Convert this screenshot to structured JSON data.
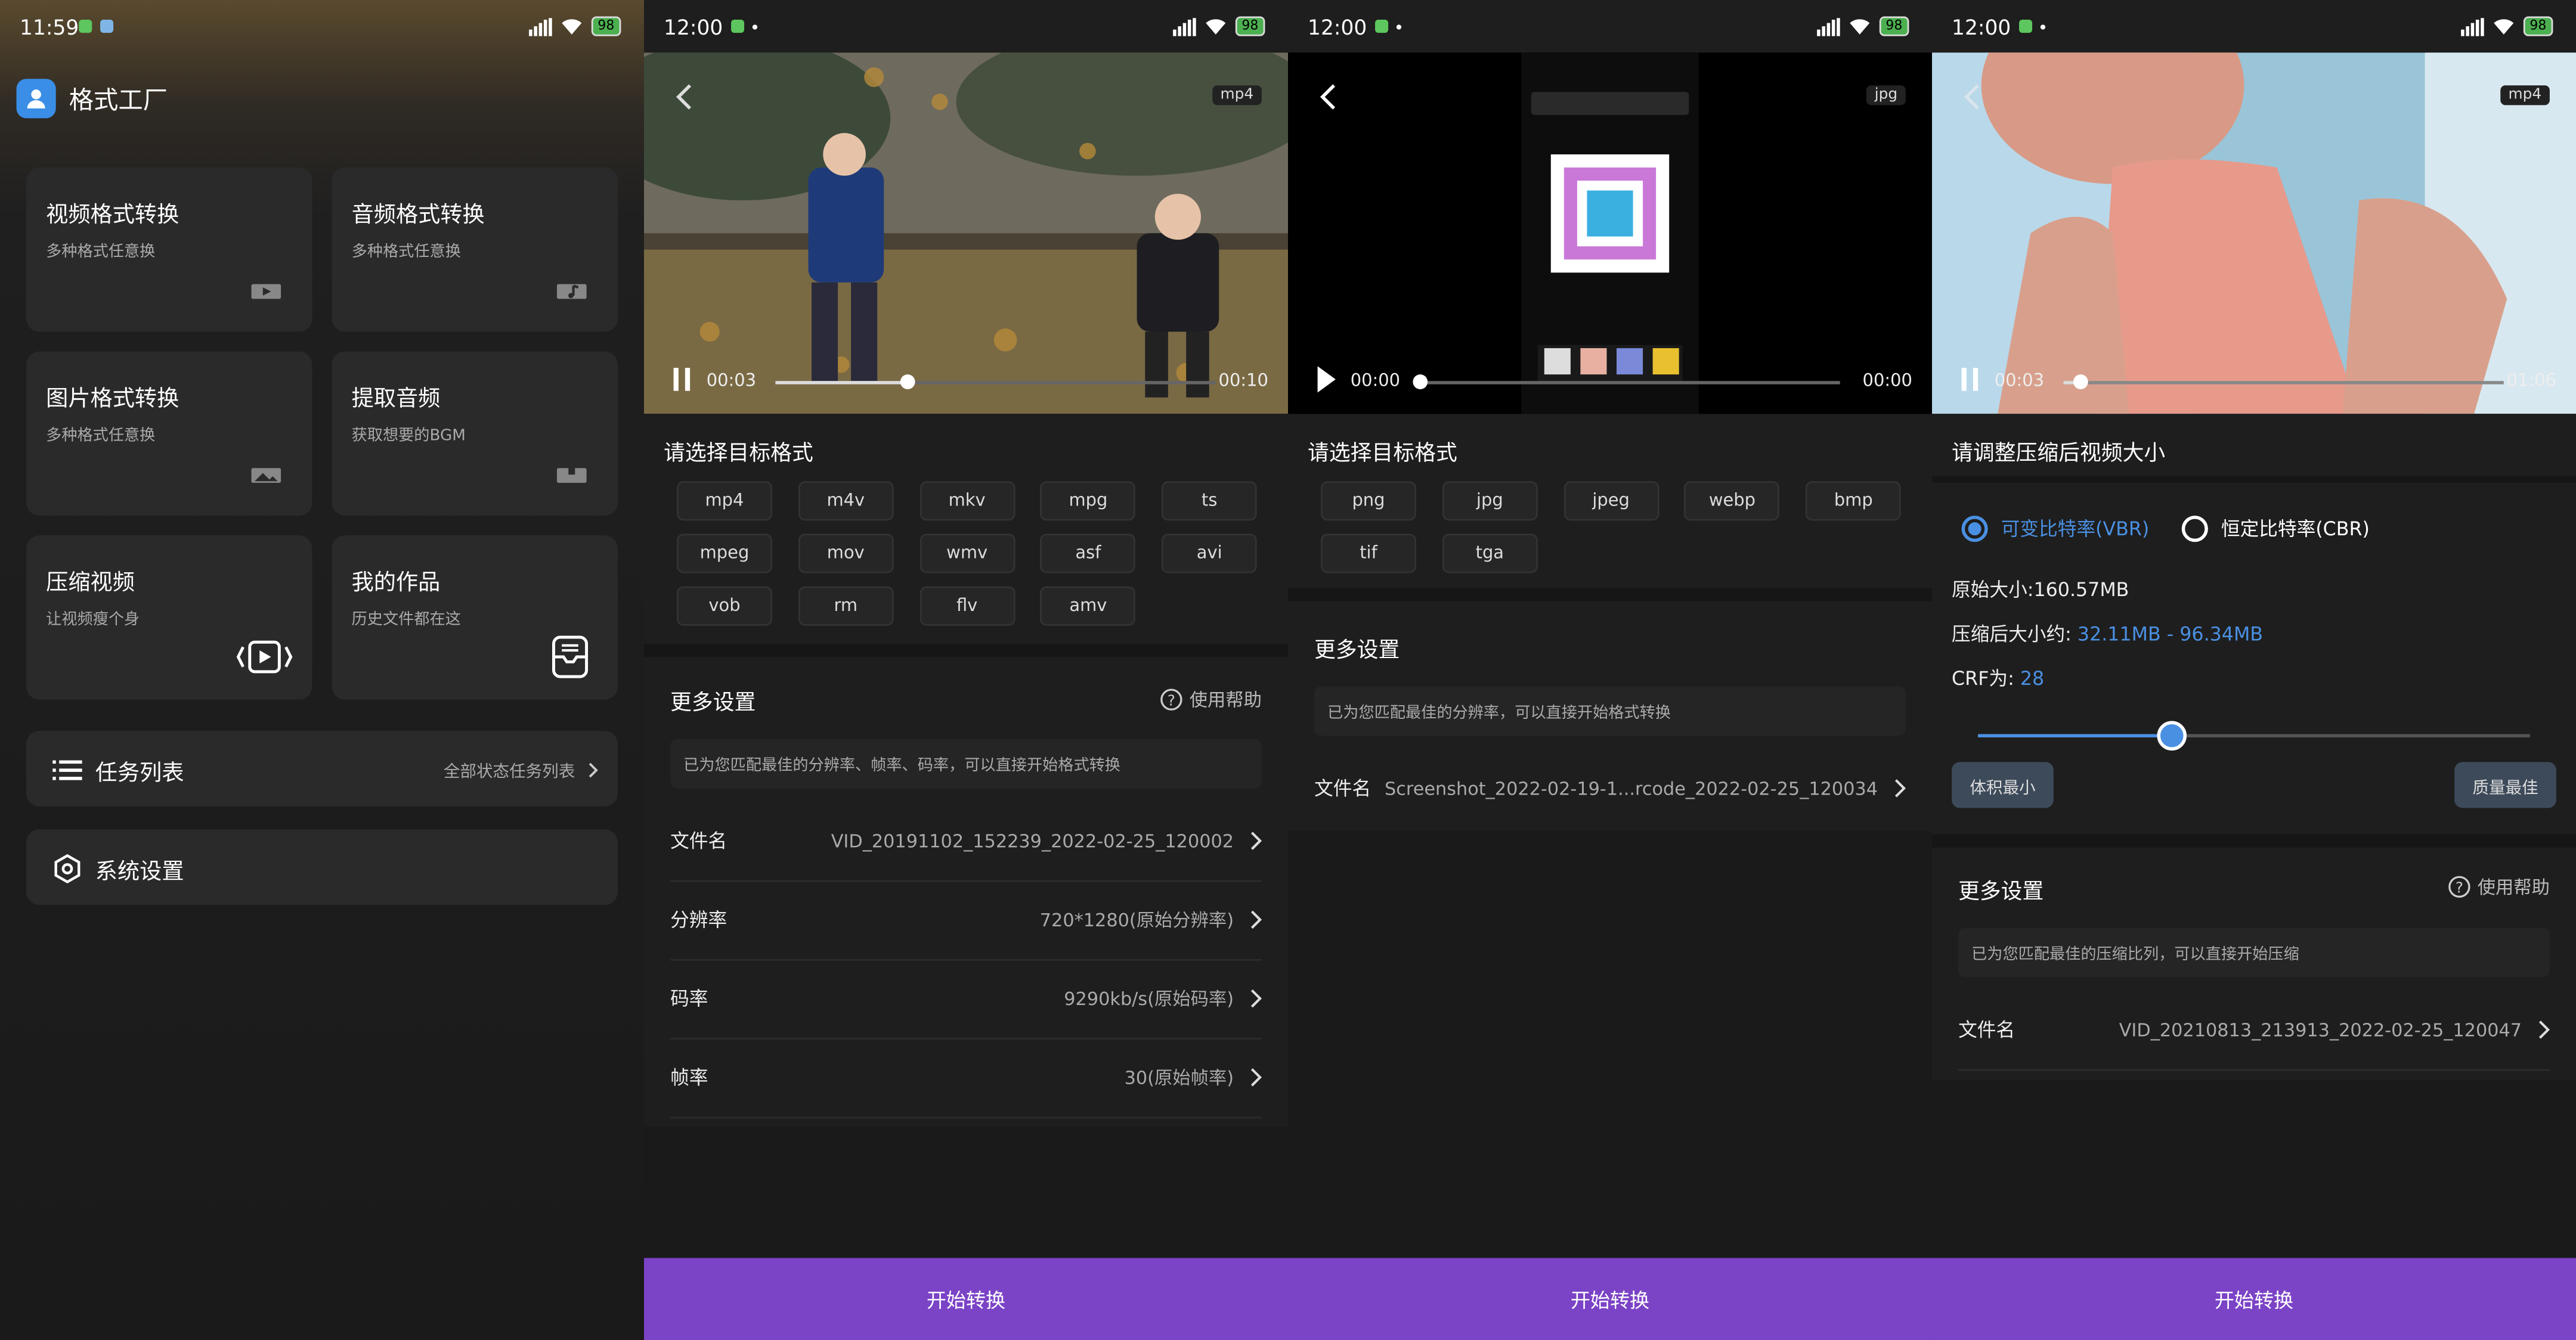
{
  "colors": {
    "accent": "#7b43c6",
    "link": "#4a90e2",
    "bg": "#1e1e1e",
    "card": "#2a2a2a"
  },
  "p1": {
    "status_time": "11:59",
    "battery": "98",
    "app_title": "格式工厂",
    "cards": [
      {
        "title": "视频格式转换",
        "sub": "多种格式任意换",
        "icon": "video-icon"
      },
      {
        "title": "音频格式转换",
        "sub": "多种格式任意换",
        "icon": "music-icon"
      },
      {
        "title": "图片格式转换",
        "sub": "多种格式任意换",
        "icon": "image-icon"
      },
      {
        "title": "提取音频",
        "sub": "获取想要的BGM",
        "icon": "extract-audio-icon"
      },
      {
        "title": "压缩视频",
        "sub": "让视频瘦个身",
        "icon": "compress-icon"
      },
      {
        "title": "我的作品",
        "sub": "历史文件都在这",
        "icon": "archive-icon"
      }
    ],
    "task_list": {
      "label": "任务列表",
      "right": "全部状态任务列表"
    },
    "settings": {
      "label": "系统设置"
    }
  },
  "p2": {
    "status_time": "12:00",
    "battery": "98",
    "format_tag": "mp4",
    "player": {
      "current": "00:03",
      "total": "00:10",
      "progress": 0.3
    },
    "section_title": "请选择目标格式",
    "formats": [
      "mp4",
      "m4v",
      "mkv",
      "mpg",
      "ts",
      "mpeg",
      "mov",
      "wmv",
      "asf",
      "avi",
      "vob",
      "rm",
      "flv",
      "amv"
    ],
    "more_title": "更多设置",
    "help": "使用帮助",
    "hint": "已为您匹配最佳的分辨率、帧率、码率，可以直接开始格式转换",
    "rows": [
      {
        "label": "文件名",
        "value": "VID_20191102_152239_2022-02-25_120002"
      },
      {
        "label": "分辨率",
        "value": "720*1280(原始分辨率)"
      },
      {
        "label": "码率",
        "value": "9290kb/s(原始码率)"
      },
      {
        "label": "帧率",
        "value": "30(原始帧率)"
      }
    ],
    "start": "开始转换"
  },
  "p3": {
    "status_time": "12:00",
    "battery": "98",
    "format_tag": "jpg",
    "player": {
      "current": "00:00",
      "total": "00:00",
      "progress": 0
    },
    "section_title": "请选择目标格式",
    "formats": [
      "png",
      "jpg",
      "jpeg",
      "webp",
      "bmp",
      "tif",
      "tga"
    ],
    "more_title": "更多设置",
    "hint": "已为您匹配最佳的分辨率，可以直接开始格式转换",
    "rows": [
      {
        "label": "文件名",
        "value": "Screenshot_2022-02-19-1...rcode_2022-02-25_120034"
      }
    ],
    "start": "开始转换"
  },
  "p4": {
    "status_time": "12:00",
    "battery": "98",
    "format_tag": "mp4",
    "player": {
      "current": "00:03",
      "total": "01:06",
      "progress": 0.04
    },
    "section_title": "请调整压缩后视频大小",
    "radio_vbr": "可变比特率(VBR)",
    "radio_cbr": "恒定比特率(CBR)",
    "orig_size": "原始大小:160.57MB",
    "compressed_label": "压缩后大小约:",
    "compressed_value": "32.11MB - 96.34MB",
    "crf_label": "CRF为:",
    "crf_value": "28",
    "slider_level": 0.35,
    "btn_min": "体积最小",
    "btn_max": "质量最佳",
    "more_title": "更多设置",
    "help": "使用帮助",
    "hint": "已为您匹配最佳的压缩比列，可以直接开始压缩",
    "rows": [
      {
        "label": "文件名",
        "value": "VID_20210813_213913_2022-02-25_120047"
      }
    ],
    "start": "开始转换"
  }
}
